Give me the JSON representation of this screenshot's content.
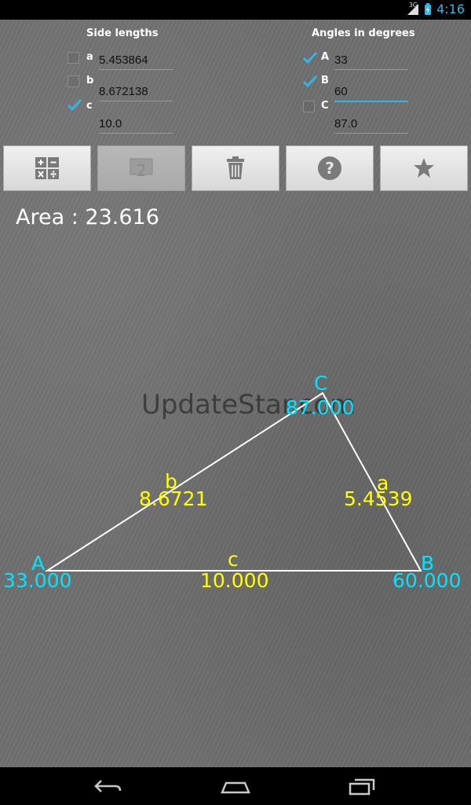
{
  "status_bar": {
    "network": "3G",
    "time": "4:16"
  },
  "form": {
    "sides_title": "Side lengths",
    "angles_title": "Angles in degrees",
    "sides": [
      {
        "label": "a",
        "checked": false,
        "value": "5.453864"
      },
      {
        "label": "b",
        "checked": false,
        "value": "8.672138"
      },
      {
        "label": "c",
        "checked": true,
        "value": "10.0"
      }
    ],
    "angles": [
      {
        "label": "A",
        "checked": true,
        "value": "33"
      },
      {
        "label": "B",
        "checked": true,
        "value": "60"
      },
      {
        "label": "C",
        "checked": false,
        "value": "87.0"
      }
    ]
  },
  "toolbar": {
    "buttons": [
      {
        "icon": "calculator-icon",
        "disabled": false
      },
      {
        "icon": "solution-2-icon",
        "disabled": true
      },
      {
        "icon": "trash-icon",
        "disabled": false
      },
      {
        "icon": "help-icon",
        "disabled": false
      },
      {
        "icon": "star-icon",
        "disabled": false
      }
    ]
  },
  "result": {
    "area": "Area : 23.616"
  },
  "triangle": {
    "vertices": {
      "A": {
        "label": "A",
        "angle": "33.000"
      },
      "B": {
        "label": "B",
        "angle": "60.000"
      },
      "C": {
        "label": "C",
        "angle": "87.000"
      }
    },
    "sides": {
      "a": {
        "label": "a",
        "length": "5.4539"
      },
      "b": {
        "label": "b",
        "length": "8.6721"
      },
      "c": {
        "label": "c",
        "length": "10.000"
      }
    },
    "colors": {
      "vertex_text": "#00e5ff",
      "side_text": "#ffff00",
      "lines": "#ffffff"
    }
  },
  "watermark": "UpdateStar.com",
  "nav_bar": {
    "buttons": [
      "back-icon",
      "home-icon",
      "recent-apps-icon"
    ]
  }
}
